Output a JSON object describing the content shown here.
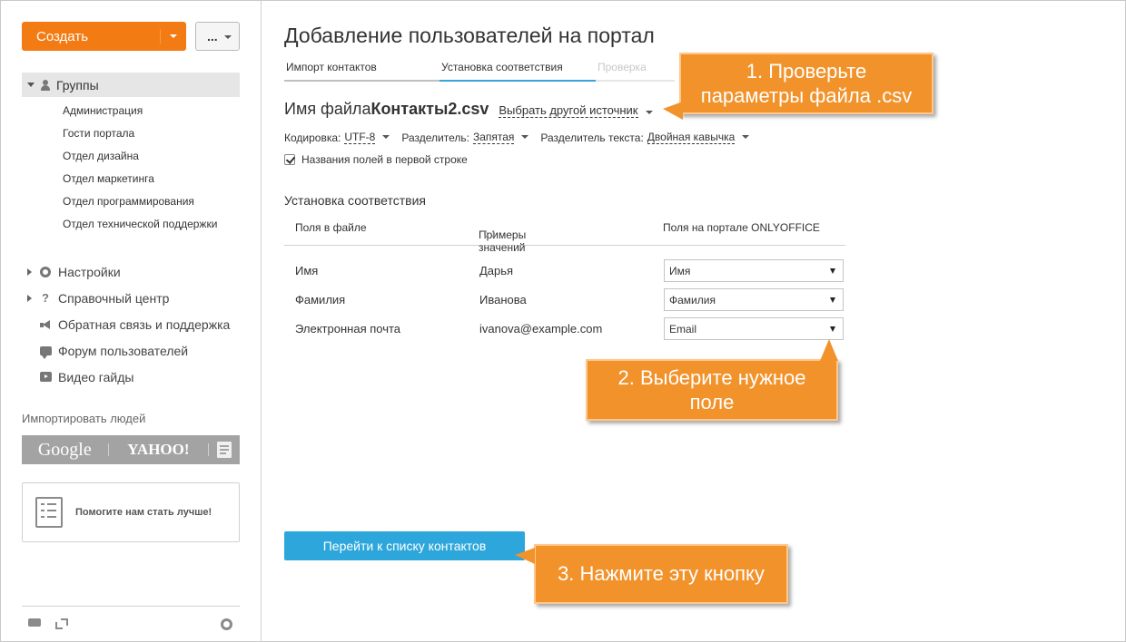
{
  "sidebar": {
    "create_label": "Создать",
    "more_label": "...",
    "groups_label": "Группы",
    "groups": [
      "Администрация",
      "Гости портала",
      "Отдел дизайна",
      "Отдел маркетинга",
      "Отдел программирования",
      "Отдел технической поддержки"
    ],
    "nav": [
      {
        "label": "Настройки",
        "icon": "gear-icon"
      },
      {
        "label": "Справочный центр",
        "icon": "question-icon"
      },
      {
        "label": "Обратная связь и поддержка",
        "icon": "megaphone-icon"
      },
      {
        "label": "Форум пользователей",
        "icon": "chat-bubble-icon"
      },
      {
        "label": "Видео гайды",
        "icon": "video-play-icon"
      }
    ],
    "question_glyph": "?",
    "import_title": "Импортировать людей",
    "import_google": "Google",
    "import_yahoo": "YAHOO!",
    "feedback_text": "Помогите нам стать лучше!"
  },
  "main": {
    "title": "Добавление пользователей на портал",
    "steps": [
      {
        "label": "Импорт контактов",
        "state": "done"
      },
      {
        "label": "Установка соответствия",
        "state": "active"
      },
      {
        "label": "Проверка",
        "state": "disabled"
      }
    ],
    "file_label": "Имя файла",
    "file_name": "Контакты2.csv",
    "other_source": "Выбрать другой источник",
    "encoding_label": "Кодировка:",
    "encoding_value": "UTF-8",
    "delimiter_label": "Разделитель:",
    "delimiter_value": "Запятая",
    "text_delimiter_label": "Разделитель текста:",
    "text_delimiter_value": "Двойная кавычка",
    "first_row_label": "Названия полей в первой строке",
    "mapping_title": "Установка соответствия",
    "col_file": "Поля в файле",
    "col_examples": "Примеры значений",
    "col_portal": "Поля на портале ONLYOFFICE",
    "rows": [
      {
        "field": "Имя",
        "example": "Дарья",
        "portal": "Имя"
      },
      {
        "field": "Фамилия",
        "example": "Иванова",
        "portal": "Фамилия"
      },
      {
        "field": "Электронная почта",
        "example": "ivanova@example.com",
        "portal": "Email"
      }
    ],
    "go_button": "Перейти к списку контактов"
  },
  "callouts": {
    "c1": "1. Проверьте параметры файла .csv",
    "c2": "2. Выберите нужное поле",
    "c3": "3. Нажмите эту кнопку"
  },
  "colors": {
    "create_button": "#f27b13",
    "primary_button": "#2da7db",
    "active_step": "#3aa3d9",
    "callout": "#f2922b"
  }
}
